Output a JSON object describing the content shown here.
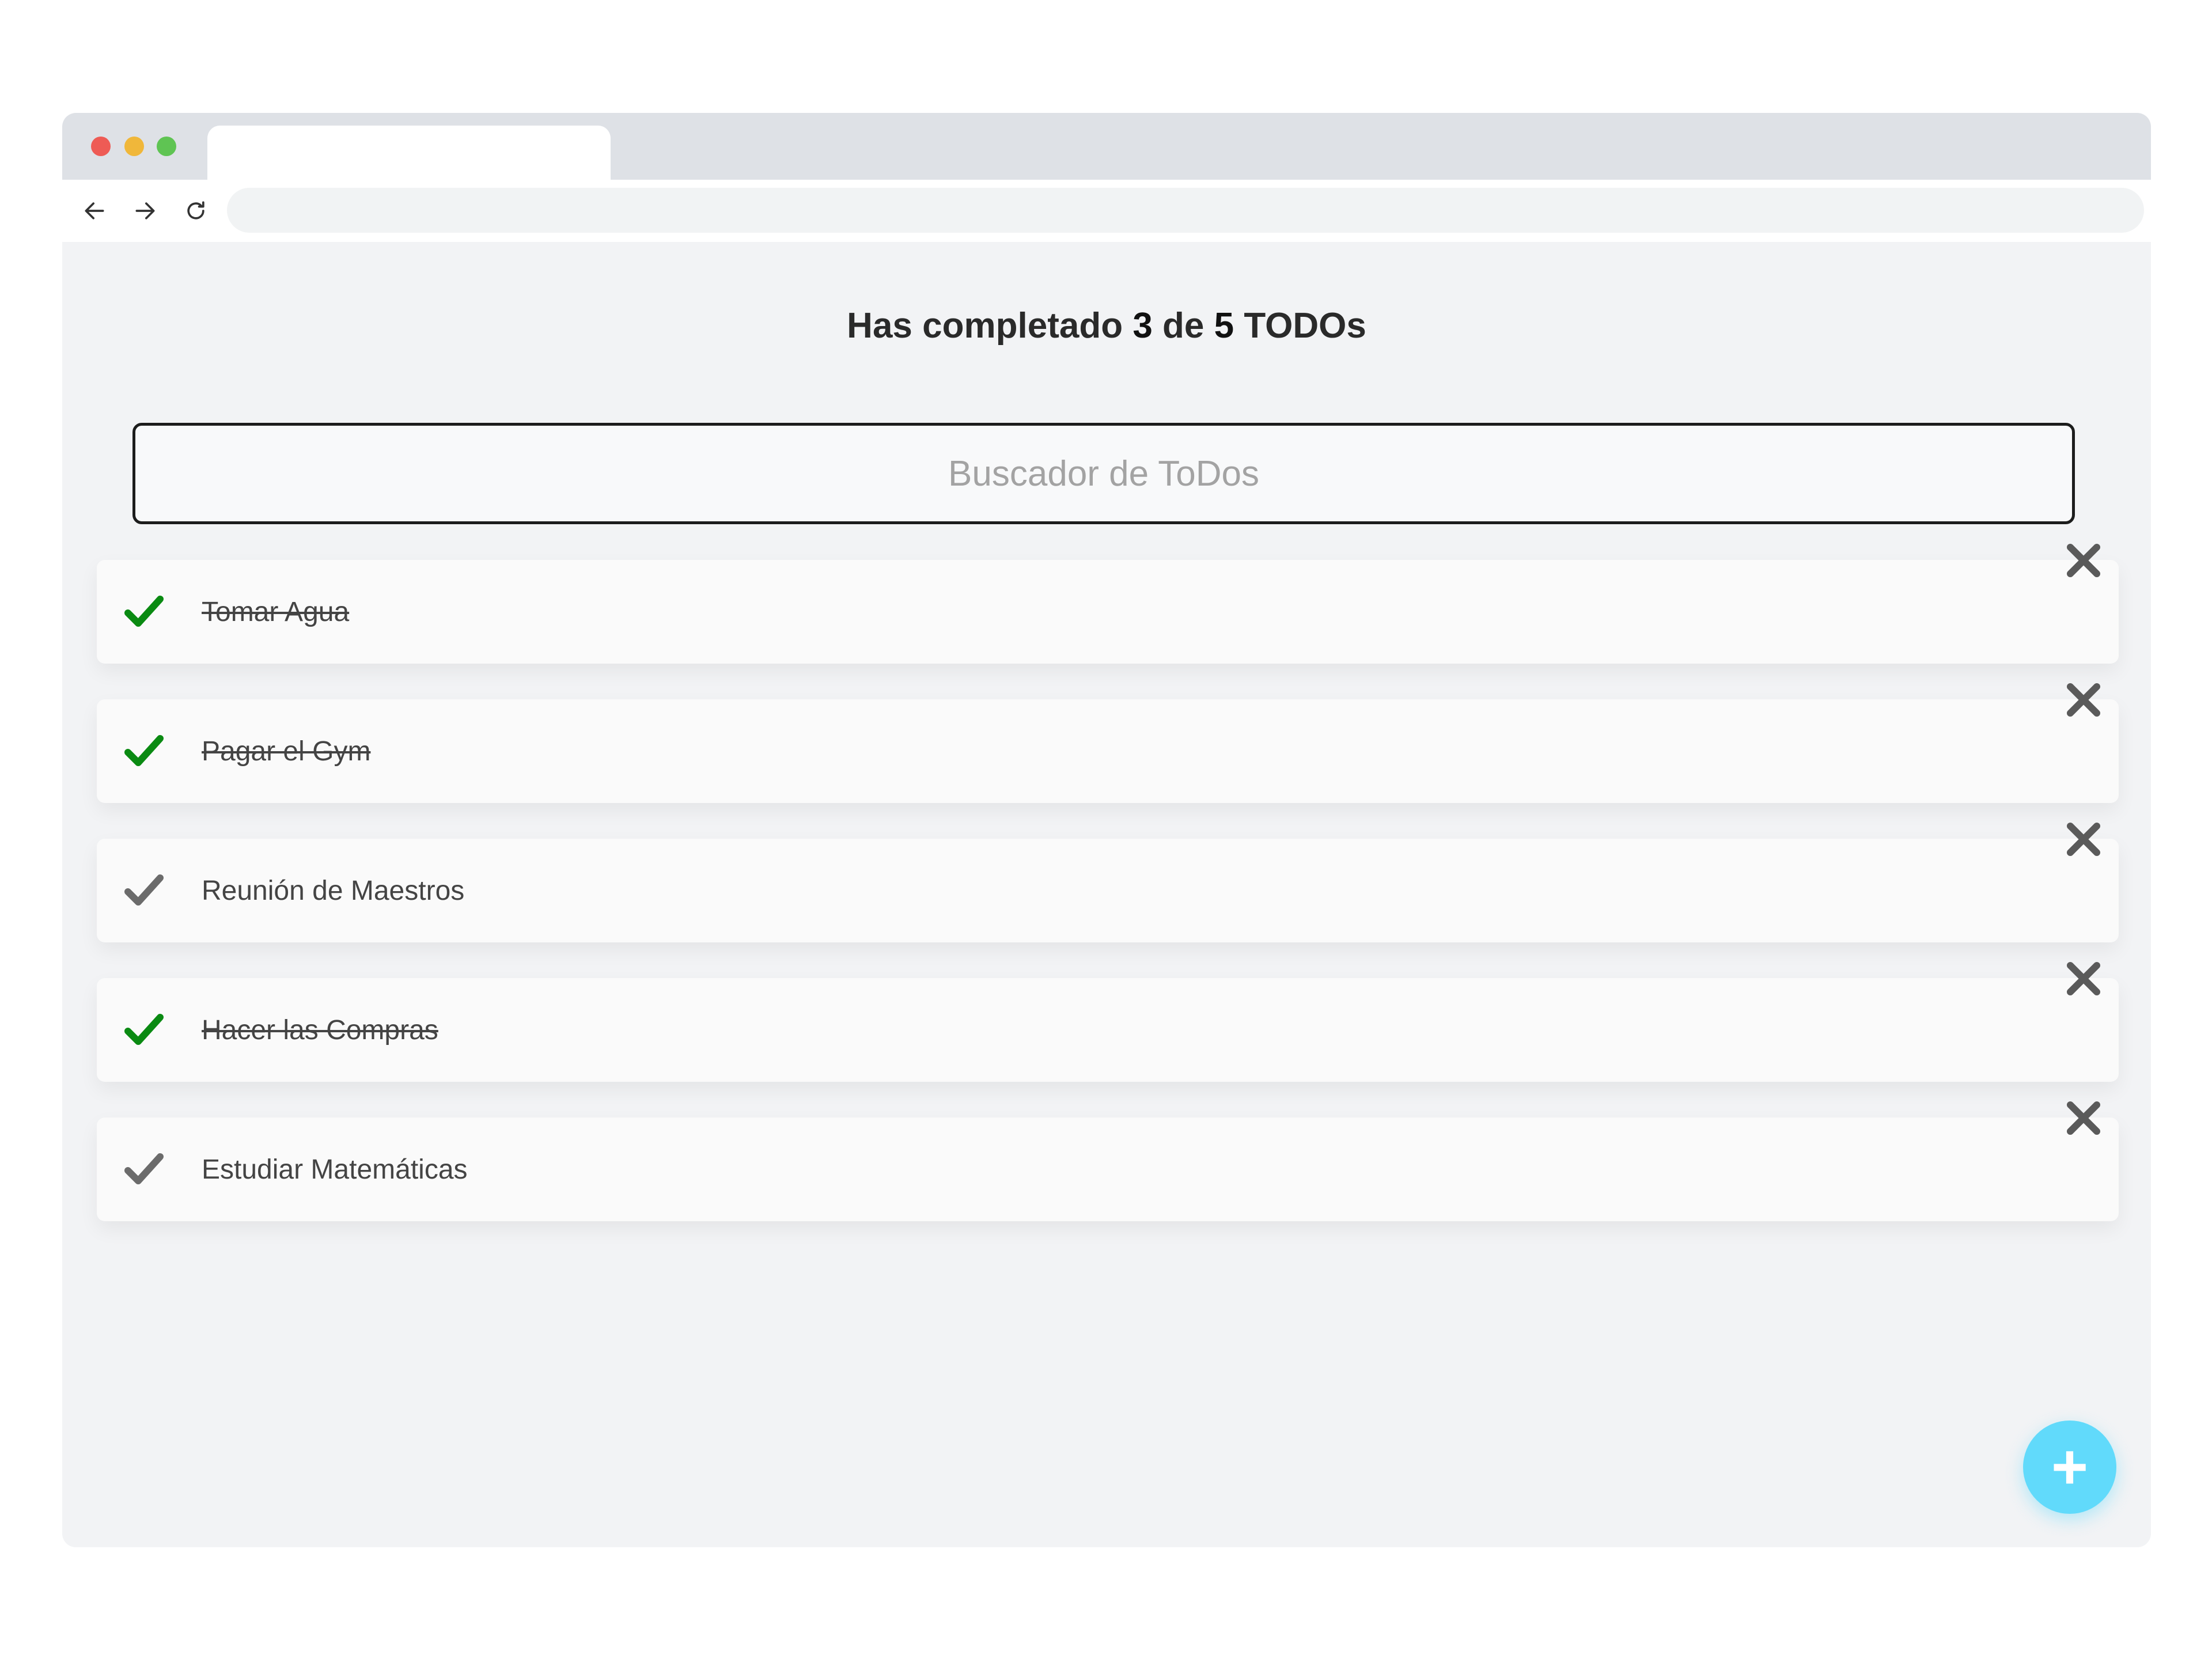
{
  "browser": {
    "traffic_lights": [
      "#ee5b55",
      "#f0b73a",
      "#5fc453"
    ],
    "nav_icons": [
      "back-arrow-icon",
      "forward-arrow-icon",
      "reload-icon"
    ]
  },
  "counter": {
    "prefix": "Has completado",
    "completed": "3",
    "middle": "de",
    "total": "5",
    "suffix": "TODOs"
  },
  "search": {
    "placeholder": "Buscador de ToDos",
    "value": ""
  },
  "todos": [
    {
      "text": "Tomar Agua",
      "completed": true
    },
    {
      "text": "Pagar el Gym",
      "completed": true
    },
    {
      "text": "Reunión de Maestros",
      "completed": false
    },
    {
      "text": "Hacer las Compras",
      "completed": true
    },
    {
      "text": "Estudiar Matemáticas",
      "completed": false
    }
  ],
  "icons": {
    "complete": "check-icon",
    "delete": "close-icon",
    "add": "plus-icon"
  },
  "colors": {
    "check_done": "#0a8a12",
    "check_pending": "#6b6b6b",
    "delete": "#5a5a5a",
    "fab": "#61dafb"
  },
  "fab": {
    "label": "+"
  }
}
